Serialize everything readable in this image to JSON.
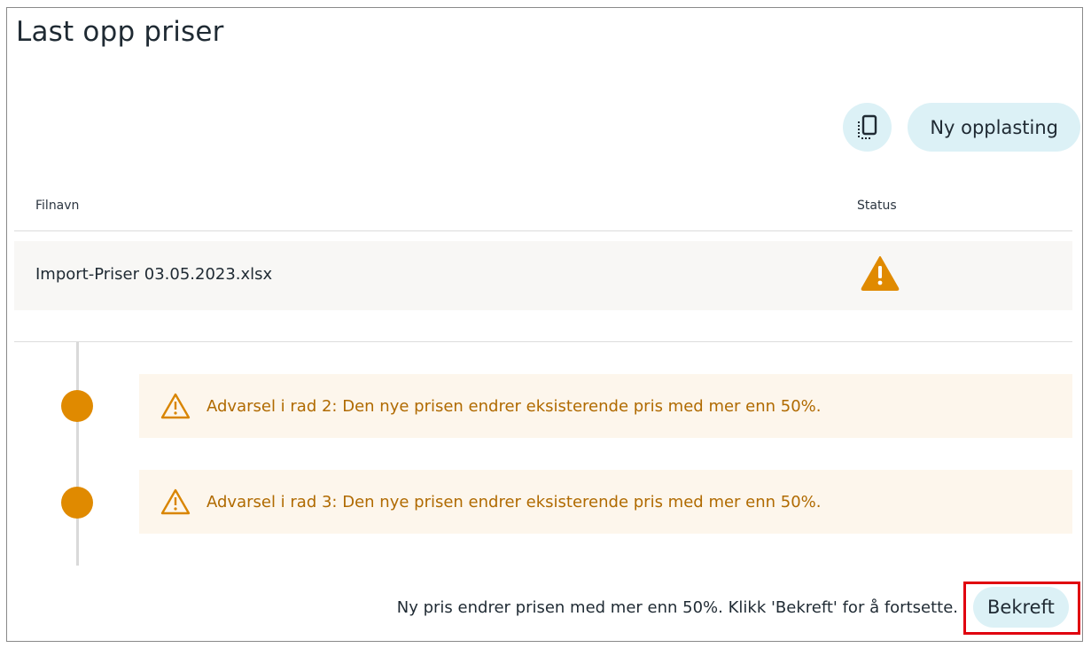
{
  "page": {
    "title": "Last opp priser"
  },
  "toolbar": {
    "copy_icon": "copy-icon",
    "new_upload_label": "Ny opplasting"
  },
  "table": {
    "columns": [
      "Filnavn",
      "Status"
    ],
    "rows": [
      {
        "filename": "Import-Priser 03.05.2023.xlsx",
        "status_icon": "warning-triangle-icon"
      }
    ]
  },
  "warnings": [
    {
      "text": "Advarsel i rad 2: Den nye prisen endrer eksisterende pris med mer enn 50%."
    },
    {
      "text": "Advarsel i rad 3: Den nye prisen endrer eksisterende pris med mer enn 50%."
    }
  ],
  "footer": {
    "message": "Ny pris endrer prisen med mer enn 50%. Klikk 'Bekreft' for å fortsette.",
    "confirm_label": "Bekreft"
  },
  "colors": {
    "accent_button": "#dcf1f6",
    "warning": "#e08a00",
    "warning_text": "#b06a00",
    "warning_bg": "#fdf6ec",
    "highlight": "#e0000f"
  }
}
